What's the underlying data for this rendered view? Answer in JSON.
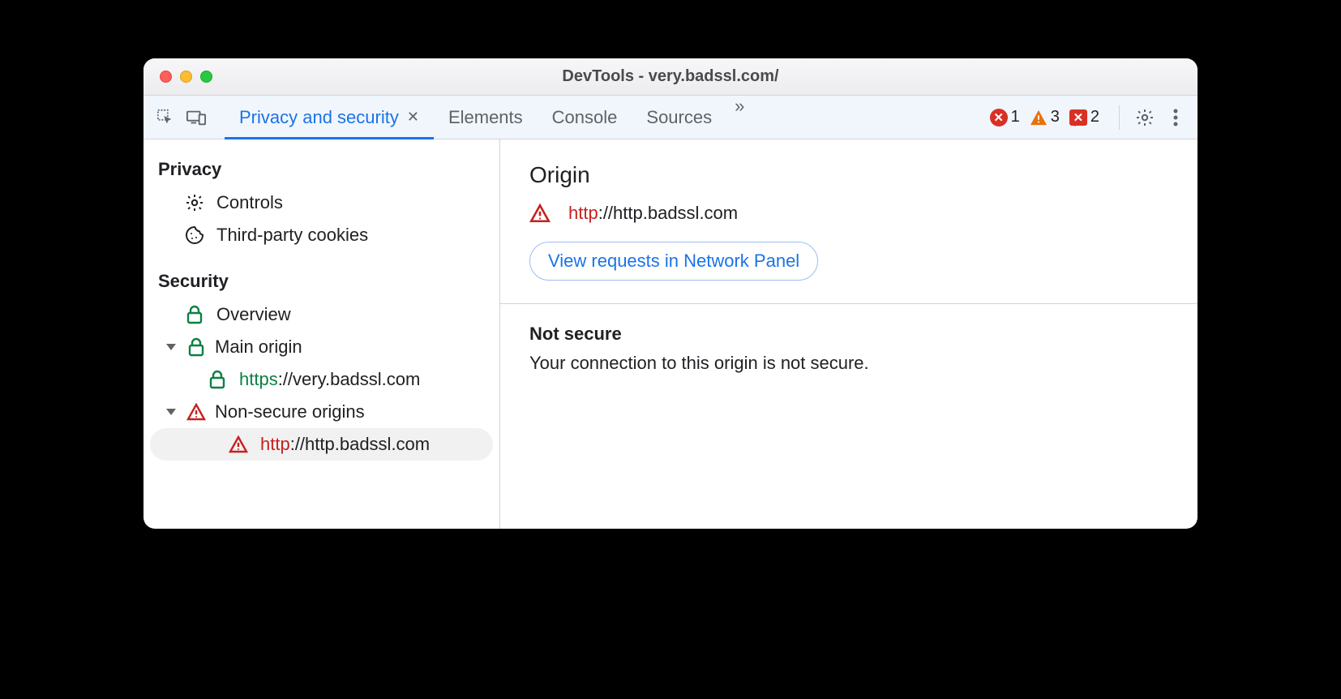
{
  "window_title": "DevTools - very.badssl.com/",
  "tabs": {
    "active": "Privacy and security",
    "others": [
      "Elements",
      "Console",
      "Sources"
    ]
  },
  "issues": {
    "errors": 1,
    "warnings": 3,
    "messages": 2
  },
  "sidebar": {
    "privacy_heading": "Privacy",
    "controls": "Controls",
    "third_party_cookies": "Third-party cookies",
    "security_heading": "Security",
    "overview": "Overview",
    "main_origin_label": "Main origin",
    "main_origin_url_scheme": "https",
    "main_origin_url_rest": "://very.badssl.com",
    "nonsecure_label": "Non-secure origins",
    "nonsecure_url_scheme": "http",
    "nonsecure_url_rest": "://http.badssl.com"
  },
  "main": {
    "origin_heading": "Origin",
    "origin_url_scheme": "http",
    "origin_url_rest": "://http.badssl.com",
    "view_requests": "View requests in Network Panel",
    "not_secure_title": "Not secure",
    "not_secure_body": "Your connection to this origin is not secure."
  }
}
